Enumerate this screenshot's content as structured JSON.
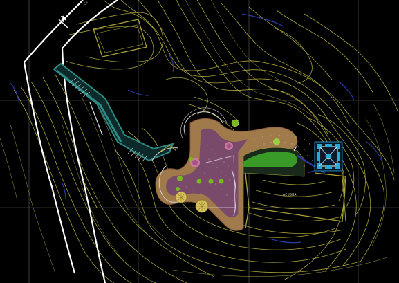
{
  "drawing": {
    "background": "#000000",
    "colors": {
      "contour": "#a8a23a",
      "contour_light": "#c8c45a",
      "index_contour": "#2a3aa8",
      "grid": "#8a8a8a",
      "road": "#ffffff",
      "walkway": "#2e8a84",
      "plaza_fill": "#7a4a6a",
      "plaza_edge": "#a07a4a",
      "lawn": "#3a9a28",
      "tree": "#7ab820",
      "structure": "#2aa8d8",
      "paving": "#b8b0a0"
    },
    "icons": [
      "tree-symbol-icon",
      "north-arrow-icon",
      "pavilion-icon"
    ],
    "labels": {
      "area_label": "ACUSBA",
      "road_label": "CA"
    }
  }
}
